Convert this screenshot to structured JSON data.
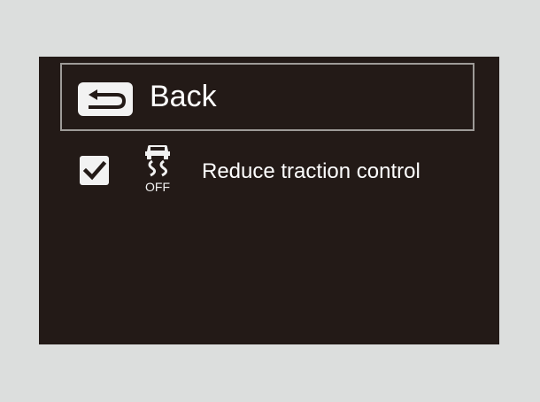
{
  "back": {
    "label": "Back",
    "icon": "back-arrow-icon"
  },
  "options": [
    {
      "label": "Reduce traction control",
      "checked": true,
      "icon": "traction-control-off-icon",
      "icon_text": "OFF"
    }
  ],
  "colors": {
    "page_background": "#dcdedd",
    "screen_background": "#231a17",
    "border": "#9e9b98",
    "text": "#ffffff"
  }
}
